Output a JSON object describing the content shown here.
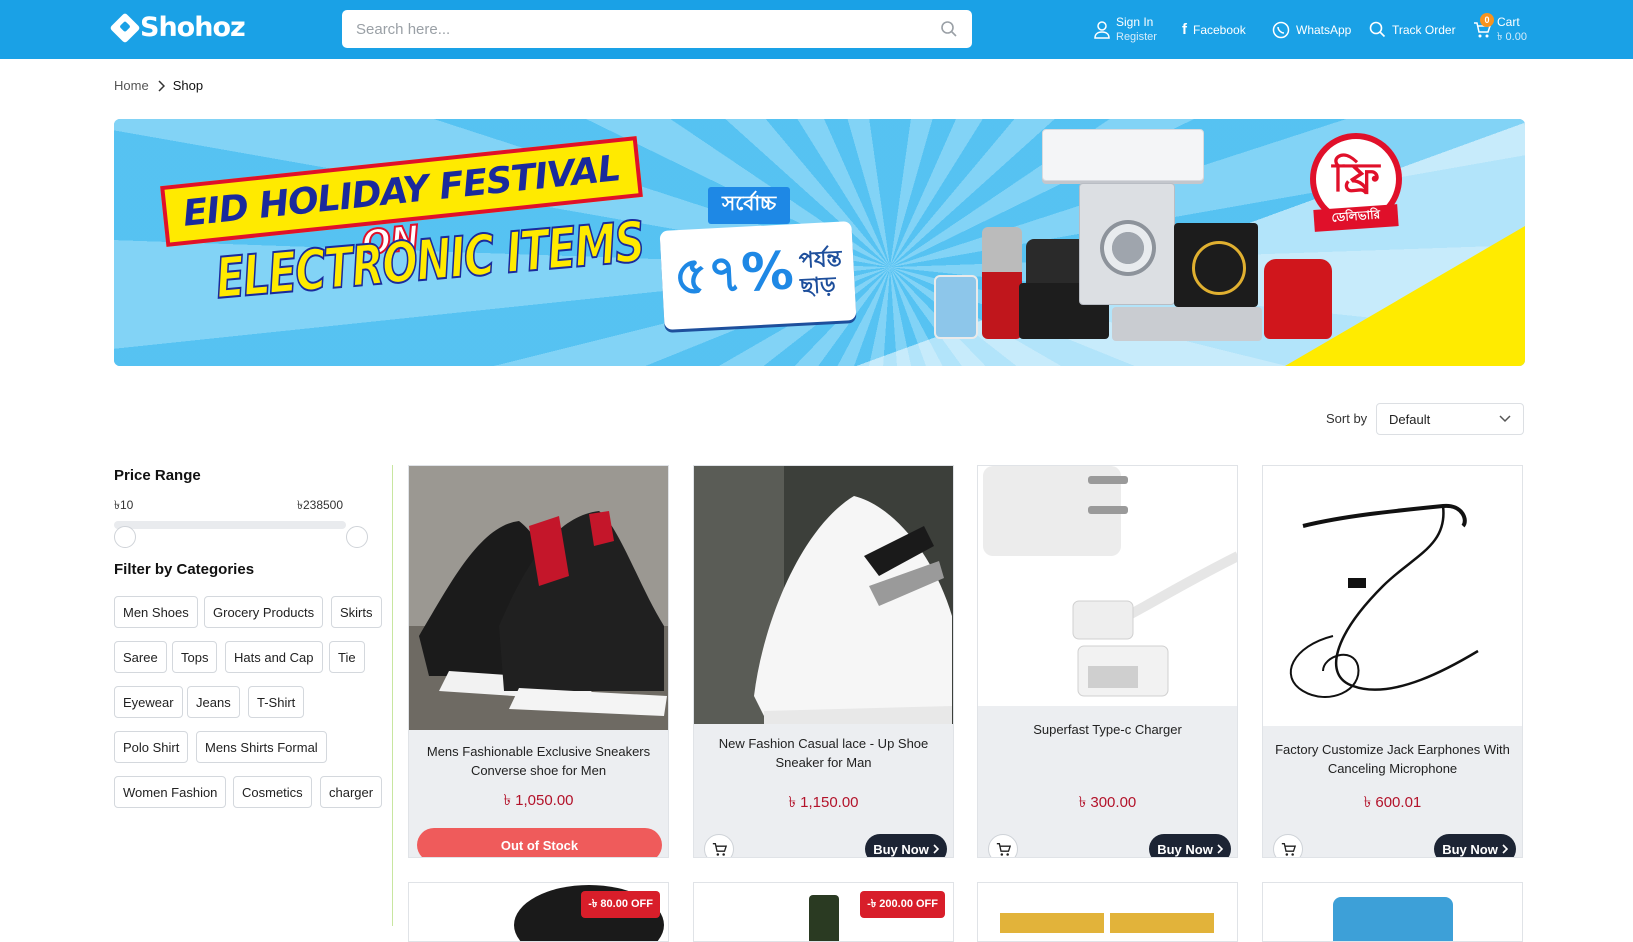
{
  "header": {
    "logo_text": "Shohoz",
    "search_placeholder": "Search here...",
    "sign_in": "Sign In",
    "register": "Register",
    "facebook": "Facebook",
    "whatsapp": "WhatsApp",
    "track_order": "Track Order",
    "cart_label": "Cart",
    "cart_count": "0",
    "cart_total": "৳ 0.00",
    "brand_color": "#1aa1e6"
  },
  "breadcrumb": {
    "home": "Home",
    "current": "Shop"
  },
  "banner": {
    "line1": "EID HOLIDAY FESTIVAL",
    "on": "ON",
    "line2": "ELECTRONIC ITEMS",
    "deal_top": "সর্বোচ্চ",
    "deal_pct": "৫৭%",
    "deal_side1": "পর্যন্ত",
    "deal_side2": "ছাড়",
    "free_text": "ফ্রি",
    "free_sub": "ডেলিভারি"
  },
  "sort": {
    "label": "Sort by",
    "value": "Default"
  },
  "sidebar": {
    "price_title": "Price Range",
    "price_min": "৳10",
    "price_max": "৳238500",
    "categories_title": "Filter by Categories",
    "categories": [
      "Men Shoes",
      "Grocery Products",
      "Skirts",
      "Saree",
      "Tops",
      "Hats and Cap",
      "Tie",
      "Eyewear",
      "Jeans",
      "T-Shirt",
      "Polo Shirt",
      "Mens Shirts Formal",
      "Women Fashion",
      "Cosmetics",
      "charger"
    ]
  },
  "products": [
    {
      "name": "Mens Fashionable Exclusive Sneakers Converse shoe for Men",
      "price": "৳ 1,050.00",
      "status": "Out of Stock"
    },
    {
      "name": "New Fashion Casual lace - Up Shoe Sneaker for Man",
      "price": "৳ 1,150.00",
      "action": "Buy Now"
    },
    {
      "name": "Superfast Type-c Charger",
      "price": "৳ 300.00",
      "action": "Buy Now"
    },
    {
      "name": "Factory Customize Jack Earphones With Canceling Microphone",
      "price": "৳ 600.01",
      "action": "Buy Now"
    }
  ],
  "next_row_badges": [
    "-৳ 80.00 OFF",
    "-৳ 200.00 OFF"
  ]
}
